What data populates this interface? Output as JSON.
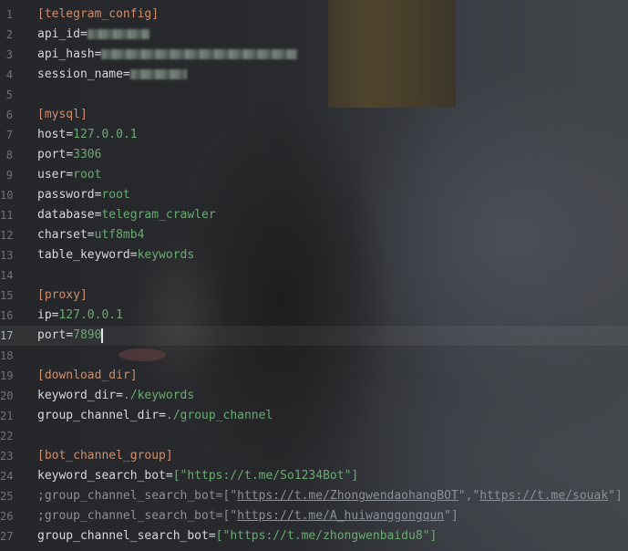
{
  "lines": [
    {
      "n": "1",
      "section": "[telegram_config]"
    },
    {
      "n": "2",
      "key": "api_id",
      "eq": "=",
      "value": "",
      "redacted": true
    },
    {
      "n": "3",
      "key": "api_hash",
      "eq": "=",
      "value": "",
      "redacted": true
    },
    {
      "n": "4",
      "key": "session_name",
      "eq": "=",
      "value": "",
      "redacted": true
    },
    {
      "n": "5"
    },
    {
      "n": "6",
      "section": "[mysql]"
    },
    {
      "n": "7",
      "key": "host",
      "eq": "=",
      "value": "127.0.0.1"
    },
    {
      "n": "8",
      "key": "port",
      "eq": "=",
      "value": "3306"
    },
    {
      "n": "9",
      "key": "user",
      "eq": "=",
      "value": "root"
    },
    {
      "n": "10",
      "key": "password",
      "eq": "=",
      "value": "root"
    },
    {
      "n": "11",
      "key": "database",
      "eq": "=",
      "value": "telegram_crawler"
    },
    {
      "n": "12",
      "key": "charset",
      "eq": "=",
      "value": "utf8mb4"
    },
    {
      "n": "13",
      "key": "table_keyword",
      "eq": "=",
      "value": "keywords"
    },
    {
      "n": "14"
    },
    {
      "n": "15",
      "section": "[proxy]"
    },
    {
      "n": "16",
      "key": "ip",
      "eq": "=",
      "value": "127.0.0.1"
    },
    {
      "n": "17",
      "key": "port",
      "eq": "=",
      "value": "7890",
      "current": true
    },
    {
      "n": "18"
    },
    {
      "n": "19",
      "section": "[download_dir]"
    },
    {
      "n": "20",
      "key": "keyword_dir",
      "eq": "=",
      "value": "./keywords"
    },
    {
      "n": "21",
      "key": "group_channel_dir",
      "eq": "=",
      "value": "./group_channel"
    },
    {
      "n": "22"
    },
    {
      "n": "23",
      "section": "[bot_channel_group]"
    },
    {
      "n": "24",
      "key": "keyword_search_bot",
      "eq": "=",
      "list": [
        "https://t.me/So1234Bot"
      ]
    },
    {
      "n": "25",
      "comment": true,
      "key": ";group_channel_search_bot",
      "eq": "=",
      "list": [
        "https://t.me/ZhongwendaohangBOT",
        "https://t.me/souak"
      ]
    },
    {
      "n": "26",
      "comment": true,
      "key": ";group_channel_search_bot",
      "eq": "=",
      "list": [
        "https://t.me/A_huiwanggongqun"
      ]
    },
    {
      "n": "27",
      "key": "group_channel_search_bot",
      "eq": "=",
      "list": [
        "https://t.me/zhongwenbaidu8"
      ]
    }
  ],
  "colors": {
    "section": "#cf8e6d",
    "key": "#d5d8dd",
    "value": "#6aab73",
    "comment": "#8c9098",
    "line_number": "#6f737a"
  }
}
